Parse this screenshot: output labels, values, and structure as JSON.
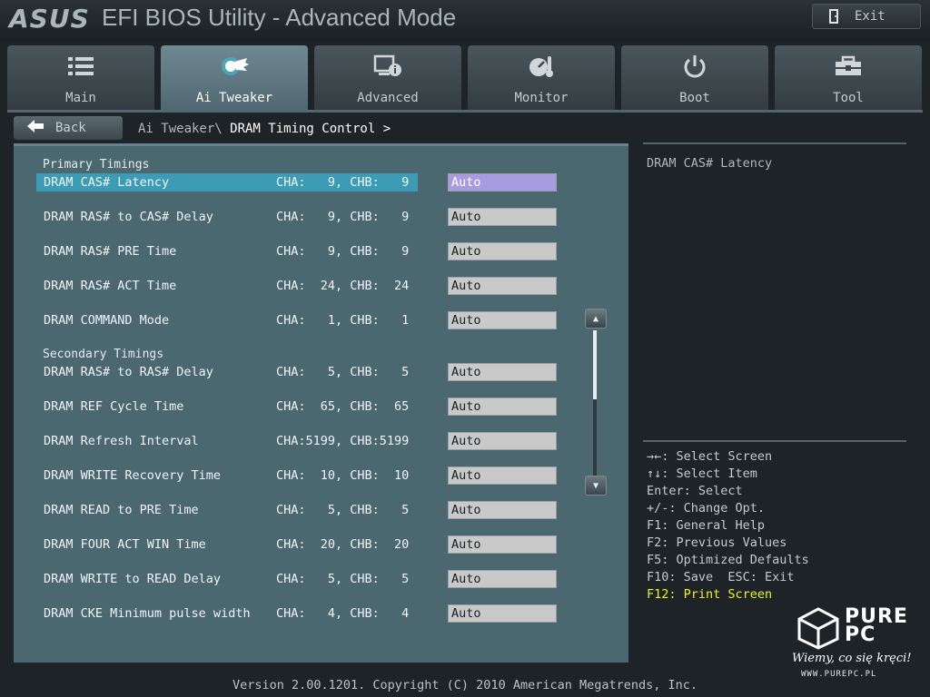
{
  "header": {
    "logo": "ASUS",
    "title": "EFI BIOS Utility - Advanced Mode",
    "exit_label": "Exit"
  },
  "tabs": [
    {
      "label": "Main",
      "icon": "list-icon",
      "active": false
    },
    {
      "label": "Ai Tweaker",
      "icon": "tweaker-icon",
      "active": true
    },
    {
      "label": "Advanced",
      "icon": "advanced-info-icon",
      "active": false
    },
    {
      "label": "Monitor",
      "icon": "monitor-gauge-icon",
      "active": false
    },
    {
      "label": "Boot",
      "icon": "power-icon",
      "active": false
    },
    {
      "label": "Tool",
      "icon": "toolbox-icon",
      "active": false
    }
  ],
  "breadcrumb": {
    "back_label": "Back",
    "parent": "Ai Tweaker\\",
    "current": " DRAM Timing Control >"
  },
  "sections": {
    "primary": "Primary Timings",
    "secondary": "Secondary Timings"
  },
  "rows": [
    {
      "label": "DRAM CAS# Latency",
      "value": "CHA:   9, CHB:   9",
      "option": "Auto",
      "selected": true
    },
    {
      "label": "DRAM RAS# to CAS# Delay",
      "value": "CHA:   9, CHB:   9",
      "option": "Auto",
      "selected": false
    },
    {
      "label": "DRAM RAS# PRE Time",
      "value": "CHA:   9, CHB:   9",
      "option": "Auto",
      "selected": false
    },
    {
      "label": "DRAM RAS# ACT Time",
      "value": "CHA:  24, CHB:  24",
      "option": "Auto",
      "selected": false
    },
    {
      "label": "DRAM COMMAND Mode",
      "value": "CHA:   1, CHB:   1",
      "option": "Auto",
      "selected": false
    },
    {
      "label": "DRAM RAS# to RAS# Delay",
      "value": "CHA:   5, CHB:   5",
      "option": "Auto",
      "selected": false
    },
    {
      "label": "DRAM REF Cycle Time",
      "value": "CHA:  65, CHB:  65",
      "option": "Auto",
      "selected": false
    },
    {
      "label": "DRAM Refresh Interval",
      "value": "CHA:5199, CHB:5199",
      "option": "Auto",
      "selected": false
    },
    {
      "label": "DRAM WRITE Recovery Time",
      "value": "CHA:  10, CHB:  10",
      "option": "Auto",
      "selected": false
    },
    {
      "label": "DRAM READ to PRE Time",
      "value": "CHA:   5, CHB:   5",
      "option": "Auto",
      "selected": false
    },
    {
      "label": "DRAM FOUR ACT WIN Time",
      "value": "CHA:  20, CHB:  20",
      "option": "Auto",
      "selected": false
    },
    {
      "label": "DRAM WRITE to READ Delay",
      "value": "CHA:   5, CHB:   5",
      "option": "Auto",
      "selected": false
    },
    {
      "label": "DRAM CKE Minimum pulse width",
      "value": "CHA:   4, CHB:   4",
      "option": "Auto",
      "selected": false
    }
  ],
  "help": {
    "text": "DRAM CAS# Latency"
  },
  "keys": [
    "→←: Select Screen",
    "↑↓: Select Item",
    "Enter: Select",
    "+/-: Change Opt.",
    "F1: General Help",
    "F2: Previous Values",
    "F5: Optimized Defaults",
    "F10: Save  ESC: Exit",
    "F12: Print Screen"
  ],
  "watermark": {
    "brand_line1": "PURE",
    "brand_line2": "PC",
    "tagline": "Wiemy, co się kręci!",
    "url": "WWW.PUREPC.PL"
  },
  "footer": "Version 2.00.1201. Copyright (C) 2010 American Megatrends, Inc.",
  "colors": {
    "panel": "#4b6871",
    "selected_row": "#3d9cb5",
    "selected_option": "#a89bdf",
    "highlight_key": "#f2ee2a"
  }
}
